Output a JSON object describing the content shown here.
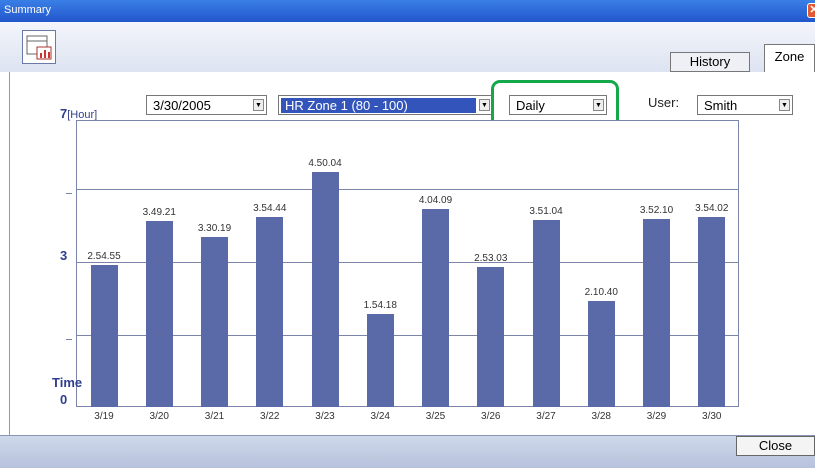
{
  "window": {
    "title": "Summary"
  },
  "toolbar": {
    "app_icon": "calendar-chart-icon"
  },
  "tabs": {
    "history": "History",
    "zone": "Zone"
  },
  "filters": {
    "date": "3/30/2005",
    "zone": "HR Zone 1 (80 - 100)",
    "period": "Daily",
    "user_label": "User:",
    "user": "Smith"
  },
  "axis": {
    "ymax_label": "7",
    "yunit": "[Hour]",
    "ymid_label": "3",
    "ylabel": "Time",
    "ymin_label": "0"
  },
  "chart_data": {
    "type": "bar",
    "categories": [
      "3/19",
      "3/20",
      "3/21",
      "3/22",
      "3/23",
      "3/24",
      "3/25",
      "3/26",
      "3/27",
      "3/28",
      "3/29",
      "3/30"
    ],
    "labels": [
      "2.54.55",
      "3.49.21",
      "3.30.19",
      "3.54.44",
      "4.50.04",
      "1.54.18",
      "4.04.09",
      "2.53.03",
      "3.51.04",
      "2.10.40",
      "3.52.10",
      "3.54.02"
    ],
    "values": [
      2.9153,
      3.8225,
      3.5053,
      3.9122,
      4.8344,
      1.905,
      4.0692,
      2.8842,
      3.8511,
      2.1778,
      3.8694,
      3.9006
    ],
    "ylim": [
      0,
      6
    ],
    "yticks": [
      0,
      3,
      6
    ],
    "color": "#5a6aa8",
    "grid": true
  },
  "footer": {
    "close_label": "Close"
  }
}
